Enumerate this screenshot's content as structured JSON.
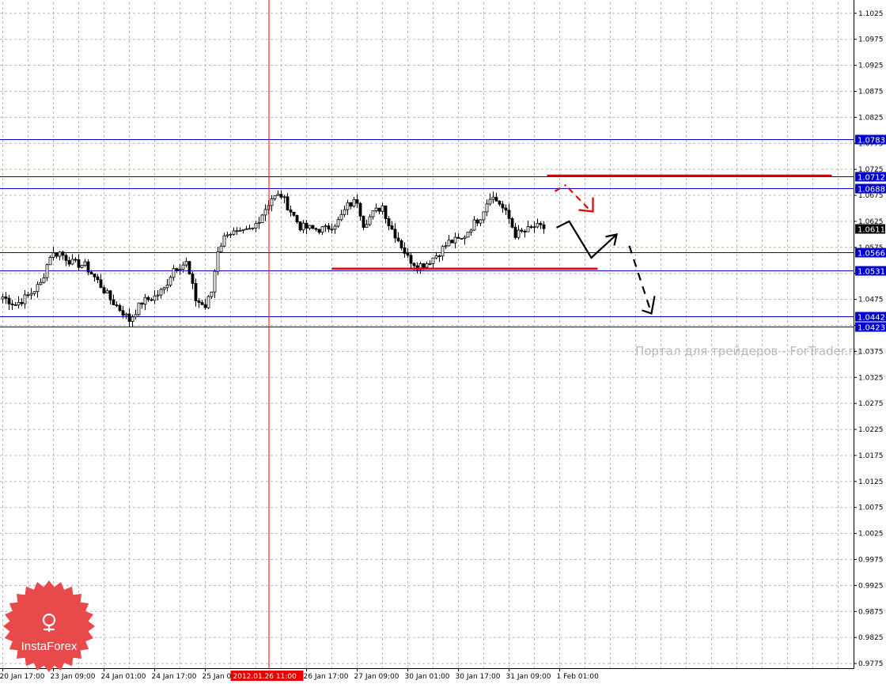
{
  "chart_data": {
    "type": "candlestick",
    "ylim": [
      0.9766,
      1.1046
    ],
    "y_ticks": [
      "1.1025",
      "1.0975",
      "1.0925",
      "1.0875",
      "1.0825",
      "1.0775",
      "1.0725",
      "1.0675",
      "1.0625",
      "1.0575",
      "1.0525",
      "1.0475",
      "1.0425",
      "1.0375",
      "1.0325",
      "1.0275",
      "1.0225",
      "1.0175",
      "1.0125",
      "1.0075",
      "1.0025",
      "0.9975",
      "0.9925",
      "0.9875",
      "0.9825",
      "0.9775"
    ],
    "x_labels": [
      {
        "index": 0,
        "text": "20 Jan 17:00"
      },
      {
        "index": 16,
        "text": "23 Jan 09:00"
      },
      {
        "index": 32,
        "text": "24 Jan 01:00"
      },
      {
        "index": 48,
        "text": "24 Jan 17:00"
      },
      {
        "index": 64,
        "text": "25 Jan 09:00"
      },
      {
        "index": 96,
        "text": "26 Jan 17:00"
      },
      {
        "index": 112,
        "text": "27 Jan 09:00"
      },
      {
        "index": 128,
        "text": "30 Jan 01:00"
      },
      {
        "index": 144,
        "text": "30 Jan 17:00"
      },
      {
        "index": 160,
        "text": "31 Jan 09:00"
      },
      {
        "index": 176,
        "text": "1 Feb 01:00"
      }
    ],
    "crosshair": {
      "index": 84,
      "label": "2012.01.26 11:00"
    },
    "levels": [
      {
        "value": 1.0783,
        "label": "1.0783"
      },
      {
        "value": 1.0712,
        "label": "1.0712"
      },
      {
        "value": 1.0688,
        "label": "1.0688"
      },
      {
        "value": 1.0566,
        "label": "1.0566"
      },
      {
        "value": 1.0531,
        "label": "1.0531"
      },
      {
        "value": 1.0442,
        "label": "1.0442"
      },
      {
        "value": 1.0423,
        "label": "1.0423"
      }
    ],
    "current_price": {
      "value": 1.0611,
      "label": "1.0611"
    },
    "resistance_line": {
      "from_index": 172,
      "to_index": 262,
      "value": 1.0713
    },
    "support_line": {
      "from_index": 104,
      "to_index": 188,
      "value": 1.0534
    },
    "forecast_path": [
      {
        "index": 175,
        "value": 1.0613
      },
      {
        "index": 179,
        "value": 1.0625
      },
      {
        "index": 186,
        "value": 1.0555
      },
      {
        "index": 194,
        "value": 1.06
      }
    ],
    "forecast_down": [
      {
        "index": 198,
        "value": 1.0578
      },
      {
        "index": 205,
        "value": 1.0448
      }
    ],
    "forecast_up_red": [
      {
        "index": 178,
        "value": 1.0695
      },
      {
        "index": 185,
        "value": 1.065
      }
    ],
    "anchors": [
      {
        "i": 0,
        "c": 1.048
      },
      {
        "i": 4,
        "c": 1.0465
      },
      {
        "i": 8,
        "c": 1.0482
      },
      {
        "i": 12,
        "c": 1.0505
      },
      {
        "i": 15,
        "c": 1.056
      },
      {
        "i": 18,
        "c": 1.0565
      },
      {
        "i": 22,
        "c": 1.0545
      },
      {
        "i": 26,
        "c": 1.054
      },
      {
        "i": 30,
        "c": 1.051
      },
      {
        "i": 34,
        "c": 1.0475
      },
      {
        "i": 38,
        "c": 1.045
      },
      {
        "i": 40,
        "c": 1.0435
      },
      {
        "i": 44,
        "c": 1.047
      },
      {
        "i": 48,
        "c": 1.048
      },
      {
        "i": 51,
        "c": 1.0495
      },
      {
        "i": 54,
        "c": 1.0535
      },
      {
        "i": 58,
        "c": 1.0545
      },
      {
        "i": 61,
        "c": 1.0475
      },
      {
        "i": 64,
        "c": 1.046
      },
      {
        "i": 66,
        "c": 1.049
      },
      {
        "i": 68,
        "c": 1.057
      },
      {
        "i": 71,
        "c": 1.0605
      },
      {
        "i": 75,
        "c": 1.06
      },
      {
        "i": 79,
        "c": 1.061
      },
      {
        "i": 82,
        "c": 1.064
      },
      {
        "i": 85,
        "c": 1.067
      },
      {
        "i": 88,
        "c": 1.0675
      },
      {
        "i": 91,
        "c": 1.0645
      },
      {
        "i": 94,
        "c": 1.0615
      },
      {
        "i": 98,
        "c": 1.061
      },
      {
        "i": 102,
        "c": 1.061
      },
      {
        "i": 106,
        "c": 1.0625
      },
      {
        "i": 109,
        "c": 1.0655
      },
      {
        "i": 112,
        "c": 1.0665
      },
      {
        "i": 114,
        "c": 1.062
      },
      {
        "i": 117,
        "c": 1.064
      },
      {
        "i": 120,
        "c": 1.0655
      },
      {
        "i": 122,
        "c": 1.062
      },
      {
        "i": 125,
        "c": 1.059
      },
      {
        "i": 128,
        "c": 1.0555
      },
      {
        "i": 131,
        "c": 1.054
      },
      {
        "i": 134,
        "c": 1.0545
      },
      {
        "i": 137,
        "c": 1.056
      },
      {
        "i": 141,
        "c": 1.0585
      },
      {
        "i": 145,
        "c": 1.059
      },
      {
        "i": 148,
        "c": 1.0615
      },
      {
        "i": 151,
        "c": 1.0635
      },
      {
        "i": 154,
        "c": 1.0675
      },
      {
        "i": 157,
        "c": 1.066
      },
      {
        "i": 160,
        "c": 1.063
      },
      {
        "i": 162,
        "c": 1.06
      },
      {
        "i": 165,
        "c": 1.0605
      },
      {
        "i": 168,
        "c": 1.0615
      },
      {
        "i": 171,
        "c": 1.0611
      }
    ],
    "candle_count": 172
  },
  "watermark": "Портал для трейдеров - ForTrader.ru",
  "logo": {
    "name": "InstaForex",
    "color": "#e8494a"
  },
  "colors": {
    "level_line": "#0000cc",
    "annotation_red": "#e60000",
    "forecast": "#000000",
    "crosshair": "#ff0000",
    "grid": "#b8b8b8"
  }
}
